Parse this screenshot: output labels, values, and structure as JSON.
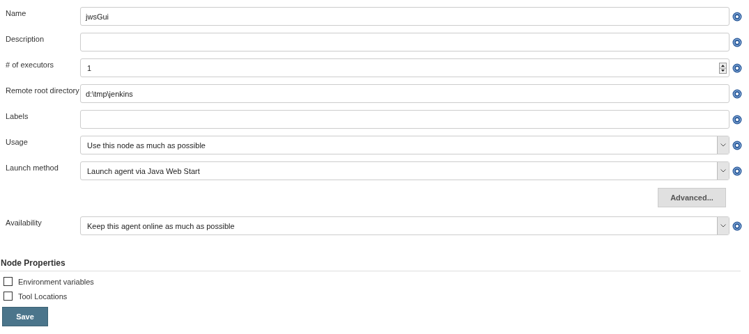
{
  "fields": [
    {
      "label": "Name",
      "kind": "text",
      "value": "jwsGui"
    },
    {
      "label": "Description",
      "kind": "text"
    },
    {
      "label": "# of executors",
      "kind": "number",
      "value": "1"
    },
    {
      "label": "Remote root directory",
      "kind": "text",
      "value": "d:\\tmp\\jenkins"
    },
    {
      "label": "Labels",
      "kind": "text"
    },
    {
      "label": "Usage",
      "kind": "select",
      "value": "Use this node as much as possible"
    },
    {
      "label": "Launch method",
      "kind": "select",
      "value": "Launch agent via Java Web Start"
    },
    {
      "kind": "button",
      "value": "Advanced..."
    },
    {
      "label": "Availability",
      "kind": "select",
      "value": "Keep this agent online as much as possible"
    }
  ],
  "node_properties": {
    "title": "Node Properties",
    "items": [
      {
        "label": "Environment variables",
        "checked": false
      },
      {
        "label": "Tool Locations",
        "checked": false
      }
    ]
  },
  "save_button": "Save"
}
